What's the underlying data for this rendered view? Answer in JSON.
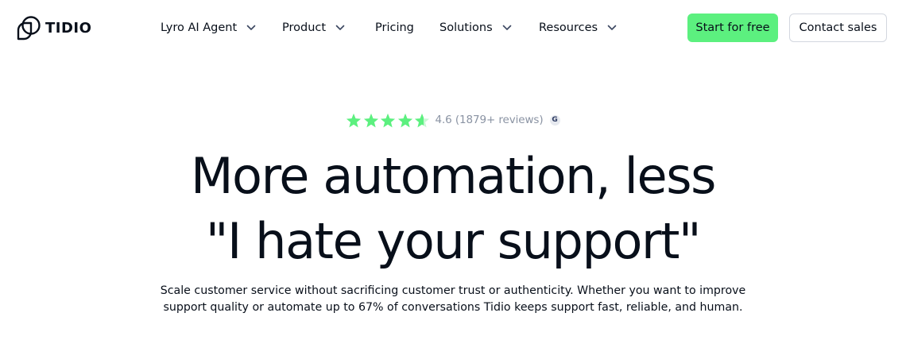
{
  "brand": {
    "name": "TIDIO"
  },
  "nav": {
    "items": [
      {
        "label": "Lyro AI Agent",
        "has_dropdown": true
      },
      {
        "label": "Product",
        "has_dropdown": true
      },
      {
        "label": "Pricing",
        "has_dropdown": false
      },
      {
        "label": "Solutions",
        "has_dropdown": true
      },
      {
        "label": "Resources",
        "has_dropdown": true
      }
    ]
  },
  "actions": {
    "primary_label": "Start for free",
    "secondary_label": "Contact sales"
  },
  "rating": {
    "stars_out_of_5": 4.6,
    "text": "4.6 (1879+ reviews)",
    "badge_letter": "G"
  },
  "hero": {
    "headline_line1": "More automation, less",
    "headline_line2": "\"I hate your support\"",
    "sub_line1": "Scale customer service without sacrificing customer trust or authenticity. Whether you want to improve",
    "sub_line2": "support quality or automate up to 67% of conversations Tidio keeps support fast, reliable, and human."
  },
  "colors": {
    "accent": "#5cf07f",
    "star": "#5cf07f",
    "text": "#080f1a",
    "muted": "#8a93a3",
    "border": "#d3d7df"
  }
}
